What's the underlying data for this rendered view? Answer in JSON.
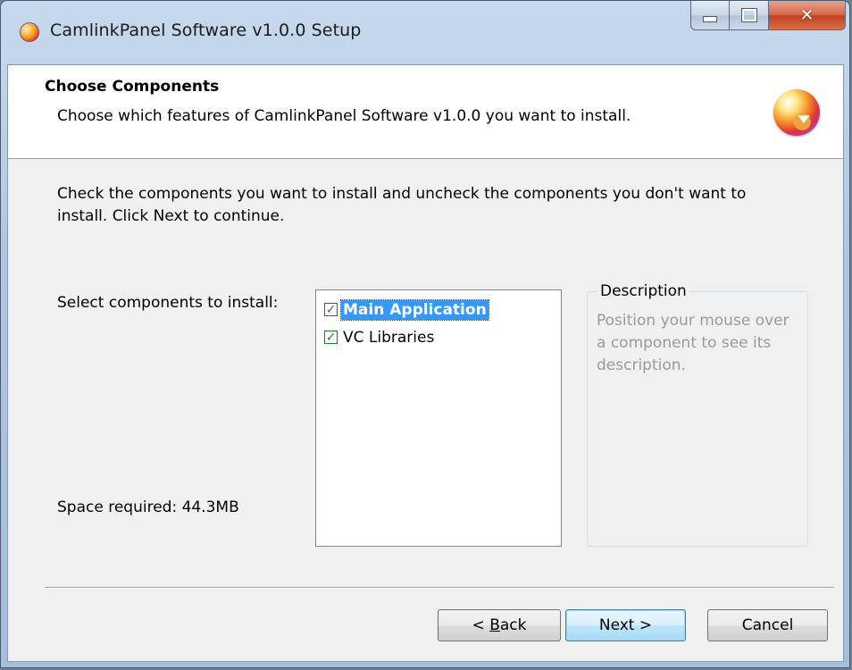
{
  "window": {
    "title": "CamlinkPanel Software v1.0.0 Setup",
    "minimize_glyph": "",
    "maximize_glyph": "",
    "close_glyph": "✕"
  },
  "header": {
    "title": "Choose Components",
    "subtitle": "Choose which features of CamlinkPanel Software v1.0.0 you want to install."
  },
  "body": {
    "intro": "Check the components you want to install and uncheck the components you don't want to install. Click Next to continue.",
    "select_label": "Select components to install:",
    "space_required": "Space required: 44.3MB"
  },
  "components": [
    {
      "label": "Main Application",
      "checked": true,
      "selected": true
    },
    {
      "label": "VC Libraries",
      "checked": true,
      "selected": false
    }
  ],
  "check_glyph": "✓",
  "description": {
    "legend": "Description",
    "text": "Position your mouse over a component to see its description."
  },
  "buttons": {
    "back_prefix": "< ",
    "back_accel": "B",
    "back_rest": "ack",
    "next": "Next >",
    "cancel": "Cancel"
  },
  "icons": {
    "app": "installer-disc-icon",
    "header": "installer-disc-icon"
  },
  "colors": {
    "selection": "#3399ff",
    "check": "#1f8a35",
    "default_button_border": "#3c7fb1"
  }
}
